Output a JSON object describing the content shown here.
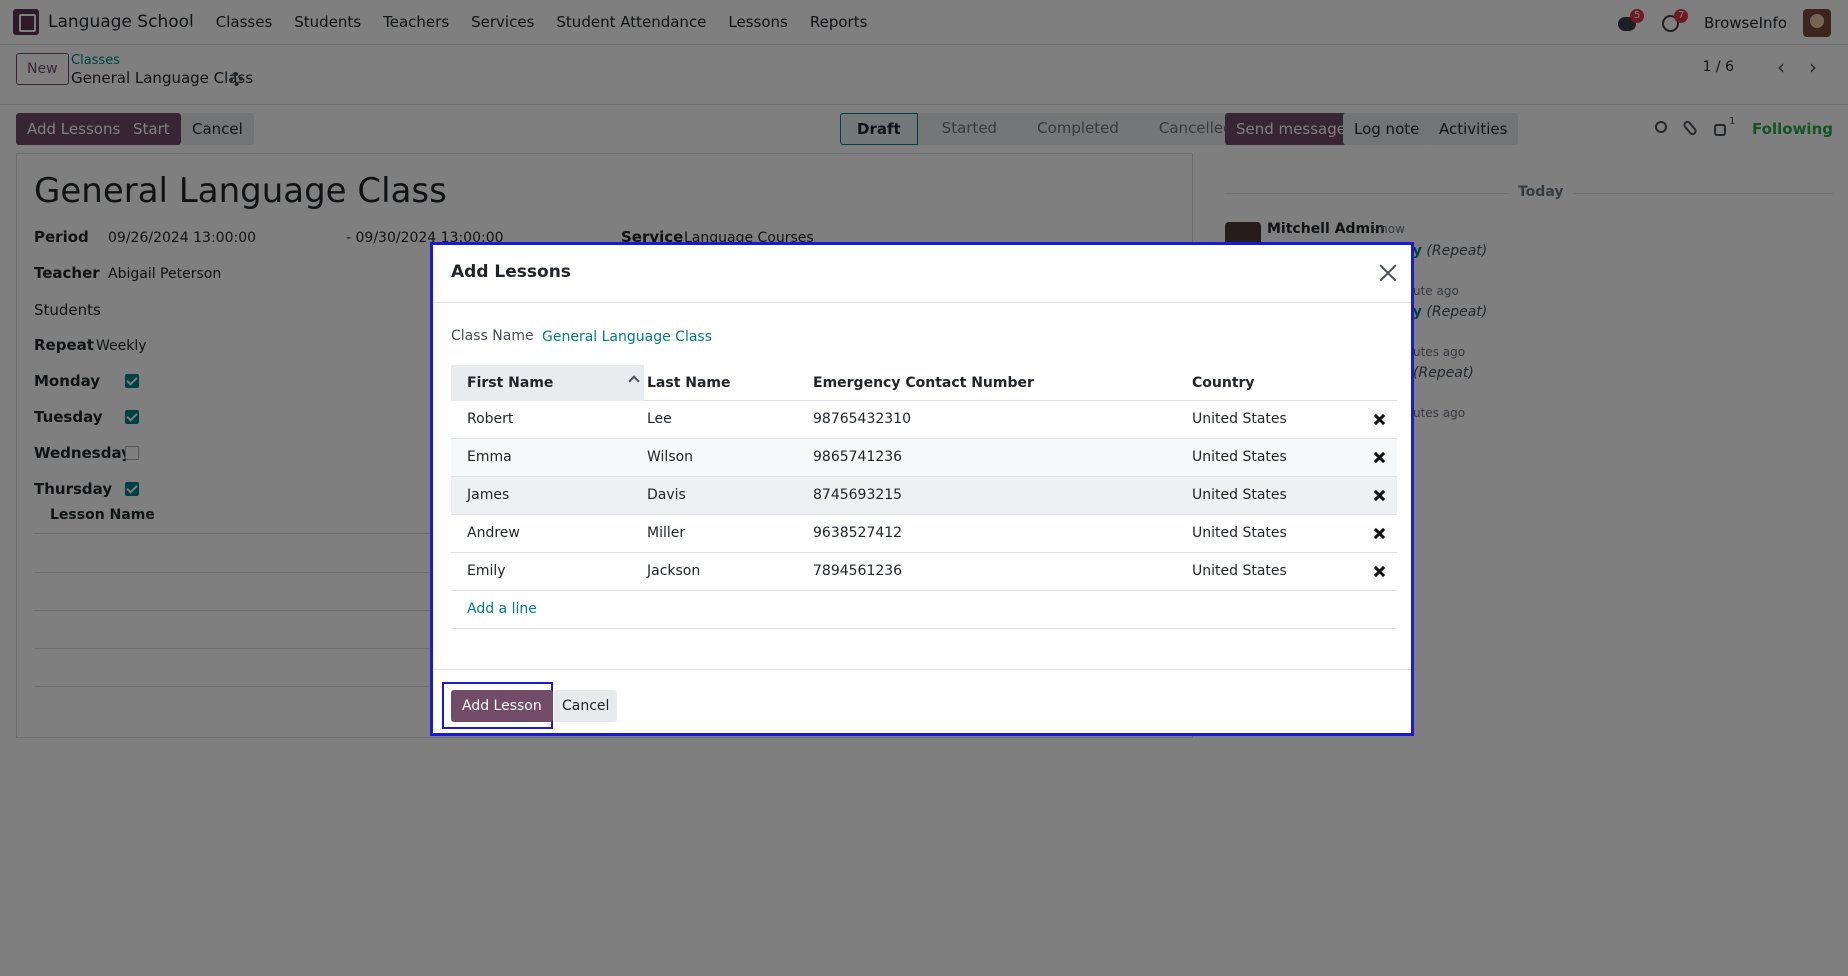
{
  "nav": {
    "app_name": "Language School",
    "items": [
      "Classes",
      "Students",
      "Teachers",
      "Services",
      "Student Attendance",
      "Lessons",
      "Reports"
    ],
    "chat_badge": "5",
    "activity_badge": "7",
    "user": "BrowseInfo"
  },
  "control": {
    "new_label": "New",
    "breadcrumb_parent": "Classes",
    "breadcrumb_current": "General Language Class",
    "pager": "1 / 6"
  },
  "actions": {
    "add_lessons": "Add Lessons",
    "start": "Start",
    "cancel": "Cancel"
  },
  "status": {
    "stages": [
      "Draft",
      "Started",
      "Completed",
      "Cancelled"
    ],
    "active": "Draft"
  },
  "form": {
    "title": "General Language Class",
    "period_label": "Period",
    "period_start": "09/26/2024 13:00:00",
    "period_end": "- 09/30/2024 13:00:00",
    "service_label": "Service",
    "service_value": "Language Courses",
    "teacher_label": "Teacher",
    "teacher_value": "Abigail Peterson",
    "students_label": "Students",
    "repeat_label": "Repeat",
    "repeat_value": "Weekly",
    "days": [
      {
        "label": "Monday",
        "checked": true
      },
      {
        "label": "Tuesday",
        "checked": true
      },
      {
        "label": "Wednesday",
        "checked": false
      },
      {
        "label": "Thursday",
        "checked": true
      }
    ],
    "lesson_col": "Lesson Name"
  },
  "chatter": {
    "send_message": "Send message",
    "log_note": "Log note",
    "activities": "Activities",
    "followers_count": "1",
    "following": "Following",
    "today": "Today",
    "author": "Mitchell Admin",
    "time": "- now",
    "fragments": [
      {
        "link": "ly",
        "text": "(Repeat)"
      },
      {
        "link": "",
        "text": "ute ago"
      },
      {
        "link": "ly",
        "text": "(Repeat)"
      },
      {
        "link": "",
        "text": "utes ago"
      },
      {
        "link": "",
        "text": "(Repeat)"
      },
      {
        "link": "",
        "text": "utes ago"
      }
    ]
  },
  "modal": {
    "title": "Add Lessons",
    "class_name_label": "Class Name",
    "class_name_value": "General Language Class",
    "columns": [
      "First Name",
      "Last Name",
      "Emergency Contact Number",
      "Country"
    ],
    "rows": [
      {
        "first": "Robert",
        "last": "Lee",
        "phone": "98765432310",
        "country": "United States"
      },
      {
        "first": "Emma",
        "last": "Wilson",
        "phone": "9865741236",
        "country": "United States"
      },
      {
        "first": "James",
        "last": "Davis",
        "phone": "8745693215",
        "country": "United States"
      },
      {
        "first": "Andrew",
        "last": "Miller",
        "phone": "9638527412",
        "country": "United States"
      },
      {
        "first": "Emily",
        "last": "Jackson",
        "phone": "7894561236",
        "country": "United States"
      }
    ],
    "add_line": "Add a line",
    "confirm": "Add Lesson",
    "cancel": "Cancel"
  },
  "colors": {
    "primary": "#714b67",
    "accent": "#017e84",
    "focus": "#1a1ad6",
    "following": "#28a745"
  }
}
